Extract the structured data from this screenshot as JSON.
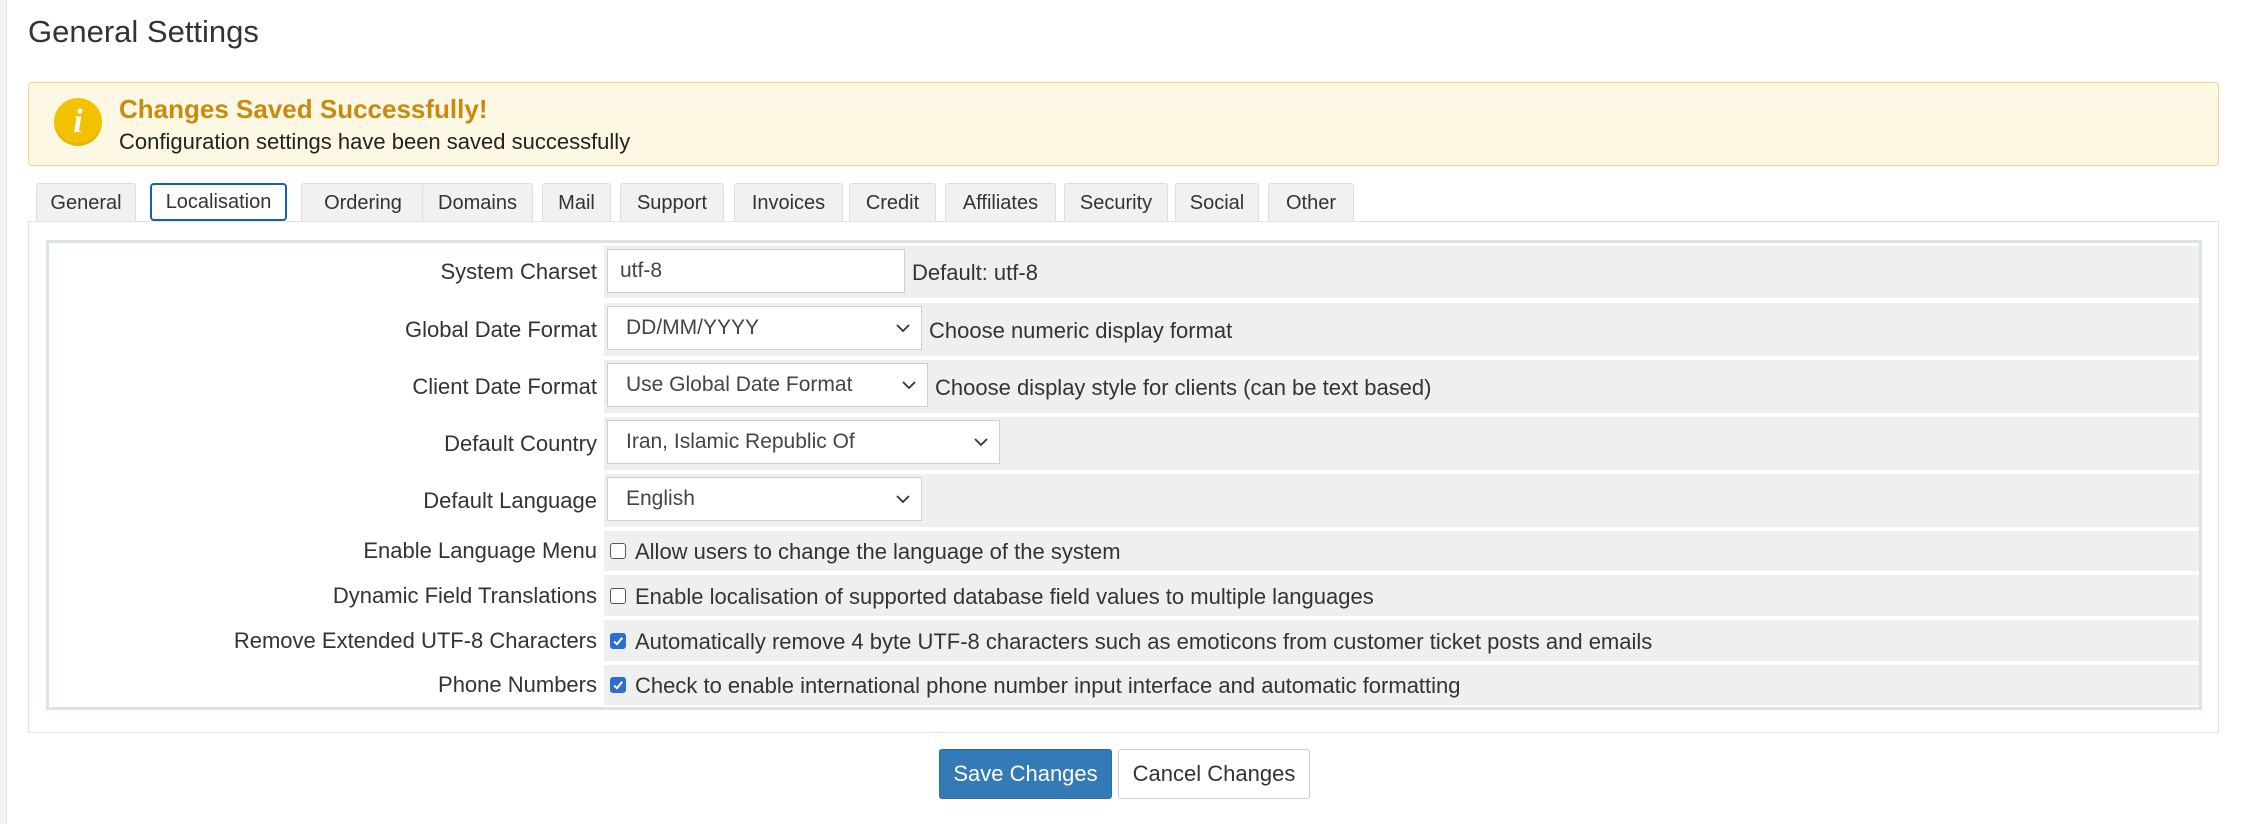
{
  "page": {
    "title": "General Settings"
  },
  "alert": {
    "icon": "info-icon",
    "icon_glyph": "i",
    "title": "Changes Saved Successfully!",
    "text": "Configuration settings have been saved successfully"
  },
  "tabs": [
    {
      "label": "General",
      "active": false
    },
    {
      "label": "Localisation",
      "active": true
    },
    {
      "label": "Ordering",
      "active": false
    },
    {
      "label": "Domains",
      "active": false
    },
    {
      "label": "Mail",
      "active": false
    },
    {
      "label": "Support",
      "active": false
    },
    {
      "label": "Invoices",
      "active": false
    },
    {
      "label": "Credit",
      "active": false
    },
    {
      "label": "Affiliates",
      "active": false
    },
    {
      "label": "Security",
      "active": false
    },
    {
      "label": "Social",
      "active": false
    },
    {
      "label": "Other",
      "active": false
    }
  ],
  "settings": {
    "charset": {
      "label": "System Charset",
      "value": "utf-8",
      "hint": "Default: utf-8"
    },
    "global_date": {
      "label": "Global Date Format",
      "value": "DD/MM/YYYY",
      "hint": "Choose numeric display format"
    },
    "client_date": {
      "label": "Client Date Format",
      "value": "Use Global Date Format",
      "hint": "Choose display style for clients (can be text based)"
    },
    "country": {
      "label": "Default Country",
      "value": "Iran, Islamic Republic Of"
    },
    "language": {
      "label": "Default Language",
      "value": "English"
    },
    "language_menu": {
      "label": "Enable Language Menu",
      "text": "Allow users to change the language of the system",
      "checked": false
    },
    "field_translations": {
      "label": "Dynamic Field Translations",
      "text": "Enable localisation of supported database field values to multiple languages",
      "checked": false
    },
    "remove_utf8": {
      "label": "Remove Extended UTF-8 Characters",
      "text": "Automatically remove 4 byte UTF-8 characters such as emoticons from customer ticket posts and emails",
      "checked": true
    },
    "phone_numbers": {
      "label": "Phone Numbers",
      "text": "Check to enable international phone number input interface and automatic formatting",
      "checked": true
    }
  },
  "buttons": {
    "save": "Save Changes",
    "cancel": "Cancel Changes"
  },
  "colors": {
    "primary": "#337ab7",
    "alert_bg": "#fcf8e3",
    "alert_title": "#c88a0f",
    "tab_active_border": "#1b5fa8",
    "checkbox": "#2b6fd1"
  }
}
